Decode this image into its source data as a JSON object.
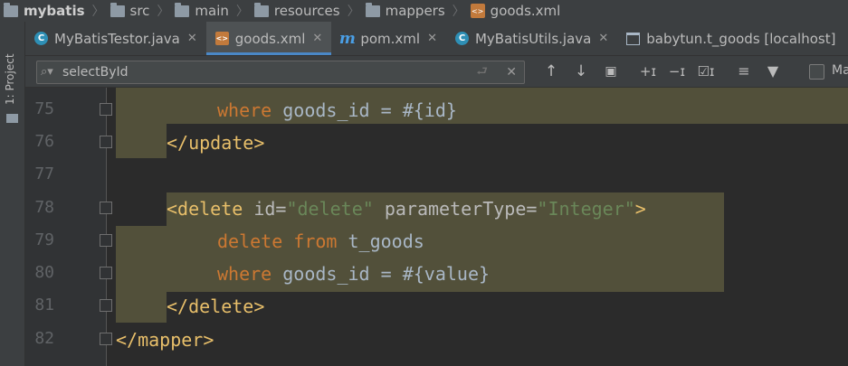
{
  "breadcrumb": {
    "items": [
      "mybatis",
      "src",
      "main",
      "resources",
      "mappers",
      "goods.xml"
    ]
  },
  "tool_stripe": {
    "project_label": "1: Project"
  },
  "tabs": [
    {
      "label": "MyBatisTestor.java",
      "icon": "c-class-icon"
    },
    {
      "label": "goods.xml",
      "icon": "xml-file-icon"
    },
    {
      "label": "pom.xml",
      "icon": "maven-icon"
    },
    {
      "label": "MyBatisUtils.java",
      "icon": "c-class-icon"
    },
    {
      "label": "babytun.t_goods [localhost]",
      "icon": "table-icon"
    }
  ],
  "search": {
    "value": "selectById",
    "match_label": "Ma"
  },
  "editor": {
    "line_numbers": [
      "75",
      "76",
      "77",
      "78",
      "79",
      "80",
      "81",
      "82"
    ],
    "lines": {
      "l75": {
        "kw": "where",
        "txt": " goods_id = #{id}"
      },
      "l76": {
        "tag": "</update>"
      },
      "l78": {
        "tag_open": "<delete",
        "attr1": " id=",
        "val1": "\"delete\"",
        "attr2": " parameterType=",
        "val2": "\"Integer\"",
        "tag_close": ">"
      },
      "l79": {
        "kw": "delete from",
        "txt": " t_goods"
      },
      "l80": {
        "kw": "where",
        "txt": " goods_id = #{value}"
      },
      "l81": {
        "tag": "</delete>"
      },
      "l82": {
        "tag": "</mapper>"
      }
    }
  },
  "colors": {
    "background": "#2b2b2b",
    "highlight": "#52503a",
    "tag": "#e8bf6a",
    "keyword": "#cc7832",
    "string": "#6a8759",
    "accent": "#4a88c7"
  }
}
